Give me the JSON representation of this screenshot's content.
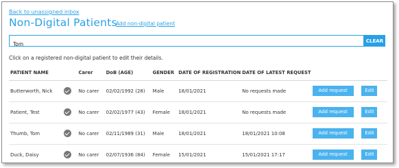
{
  "nav": {
    "back_label": "Back to unassigned inbox"
  },
  "header": {
    "title": "Non-Digital Patients",
    "add_link": "Add non-digital patient"
  },
  "search": {
    "value": "Tom",
    "clear_label": "CLEAR"
  },
  "hint": "Click on a registered non-digital patient to edit their details.",
  "table": {
    "headers": [
      "PATIENT NAME",
      "",
      "Carer",
      "DoB (AGE)",
      "GENDER",
      "DATE OF REGISTRATION",
      "DATE OF LATEST REQUEST",
      "",
      ""
    ],
    "rows": [
      {
        "name": "Butterworth, Nick",
        "carer": "No carer",
        "dob": "02/02/1992 (28)",
        "gender": "Male",
        "registered": "18/01/2021",
        "latest": "No requests made",
        "request_label": "Add request",
        "edit_label": "Edit"
      },
      {
        "name": "Patient, Test",
        "carer": "No carer",
        "dob": "02/02/1977 (43)",
        "gender": "Female",
        "registered": "18/01/2021",
        "latest": "No requests made",
        "request_label": "Add request",
        "edit_label": "Edit"
      },
      {
        "name": "Thumb, Tom",
        "carer": "No carer",
        "dob": "02/11/1989 (31)",
        "gender": "Male",
        "registered": "18/01/2021",
        "latest": "18/01/2021 10:08",
        "request_label": "Add request",
        "edit_label": "Edit"
      },
      {
        "name": "Duck, Daisy",
        "carer": "No carer",
        "dob": "02/07/1936 (84)",
        "gender": "Female",
        "registered": "15/01/2021",
        "latest": "15/01/2021 17:17",
        "request_label": "Add request",
        "edit_label": "Edit"
      }
    ]
  },
  "colors": {
    "accent": "#29a0e6",
    "button": "#4ab2ee",
    "check": "#777777"
  }
}
